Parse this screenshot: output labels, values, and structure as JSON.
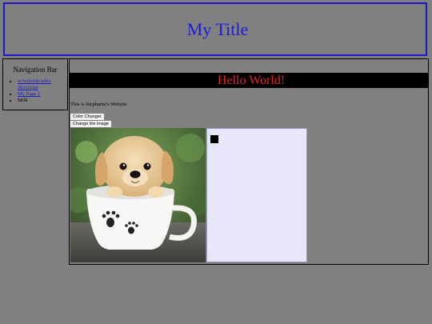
{
  "header": {
    "title": "My Title"
  },
  "nav": {
    "title": "Navigation Bar",
    "items": [
      {
        "label": "w3schools table directions",
        "link": true
      },
      {
        "label": "My Page 2",
        "link": true
      },
      {
        "label": "Milk",
        "link": false
      }
    ]
  },
  "main": {
    "hello": "Hello World!",
    "site_text": "This is Stephanie's Website",
    "buttons": {
      "color": "Color Changer",
      "image": "Change the image"
    }
  },
  "colors": {
    "page_bg": "#808080",
    "title_text": "#1c1cd6",
    "hello_text": "#e8232a",
    "hello_bg": "#000000",
    "canvas_bg": "#e8e6fb"
  }
}
